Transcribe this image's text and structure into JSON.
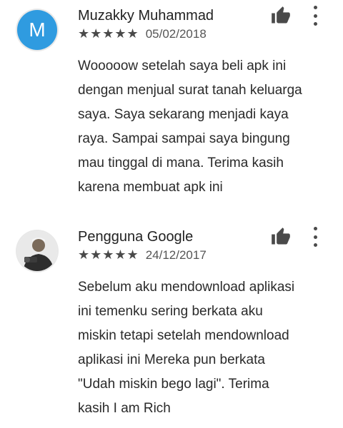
{
  "reviews": [
    {
      "avatar_letter": "M",
      "avatar_color": "#2f9be0",
      "author": "Muzakky Muhammad",
      "stars": "★★★★★",
      "rating": 5,
      "date": "05/02/2018",
      "text": "Wooooow setelah saya beli apk ini\ndengan menjual surat tanah keluarga\nsaya. Saya sekarang menjadi kaya\nraya. Sampai sampai saya bingung\nmau tinggal di mana. Terima kasih\nkarena membuat apk ini",
      "icons": {
        "like": "thumb-up-icon",
        "menu": "more-vert-icon"
      }
    },
    {
      "author": "Pengguna Google",
      "stars": "★★★★★",
      "rating": 5,
      "date": "24/12/2017",
      "text": "Sebelum aku mendownload aplikasi\nini temenku sering berkata aku\nmiskin tetapi setelah mendownload\naplikasi ini Mereka pun berkata\n\"Udah miskin bego lagi\". Terima\nkasih I am Rich",
      "icons": {
        "like": "thumb-up-icon",
        "menu": "more-vert-icon"
      }
    }
  ]
}
